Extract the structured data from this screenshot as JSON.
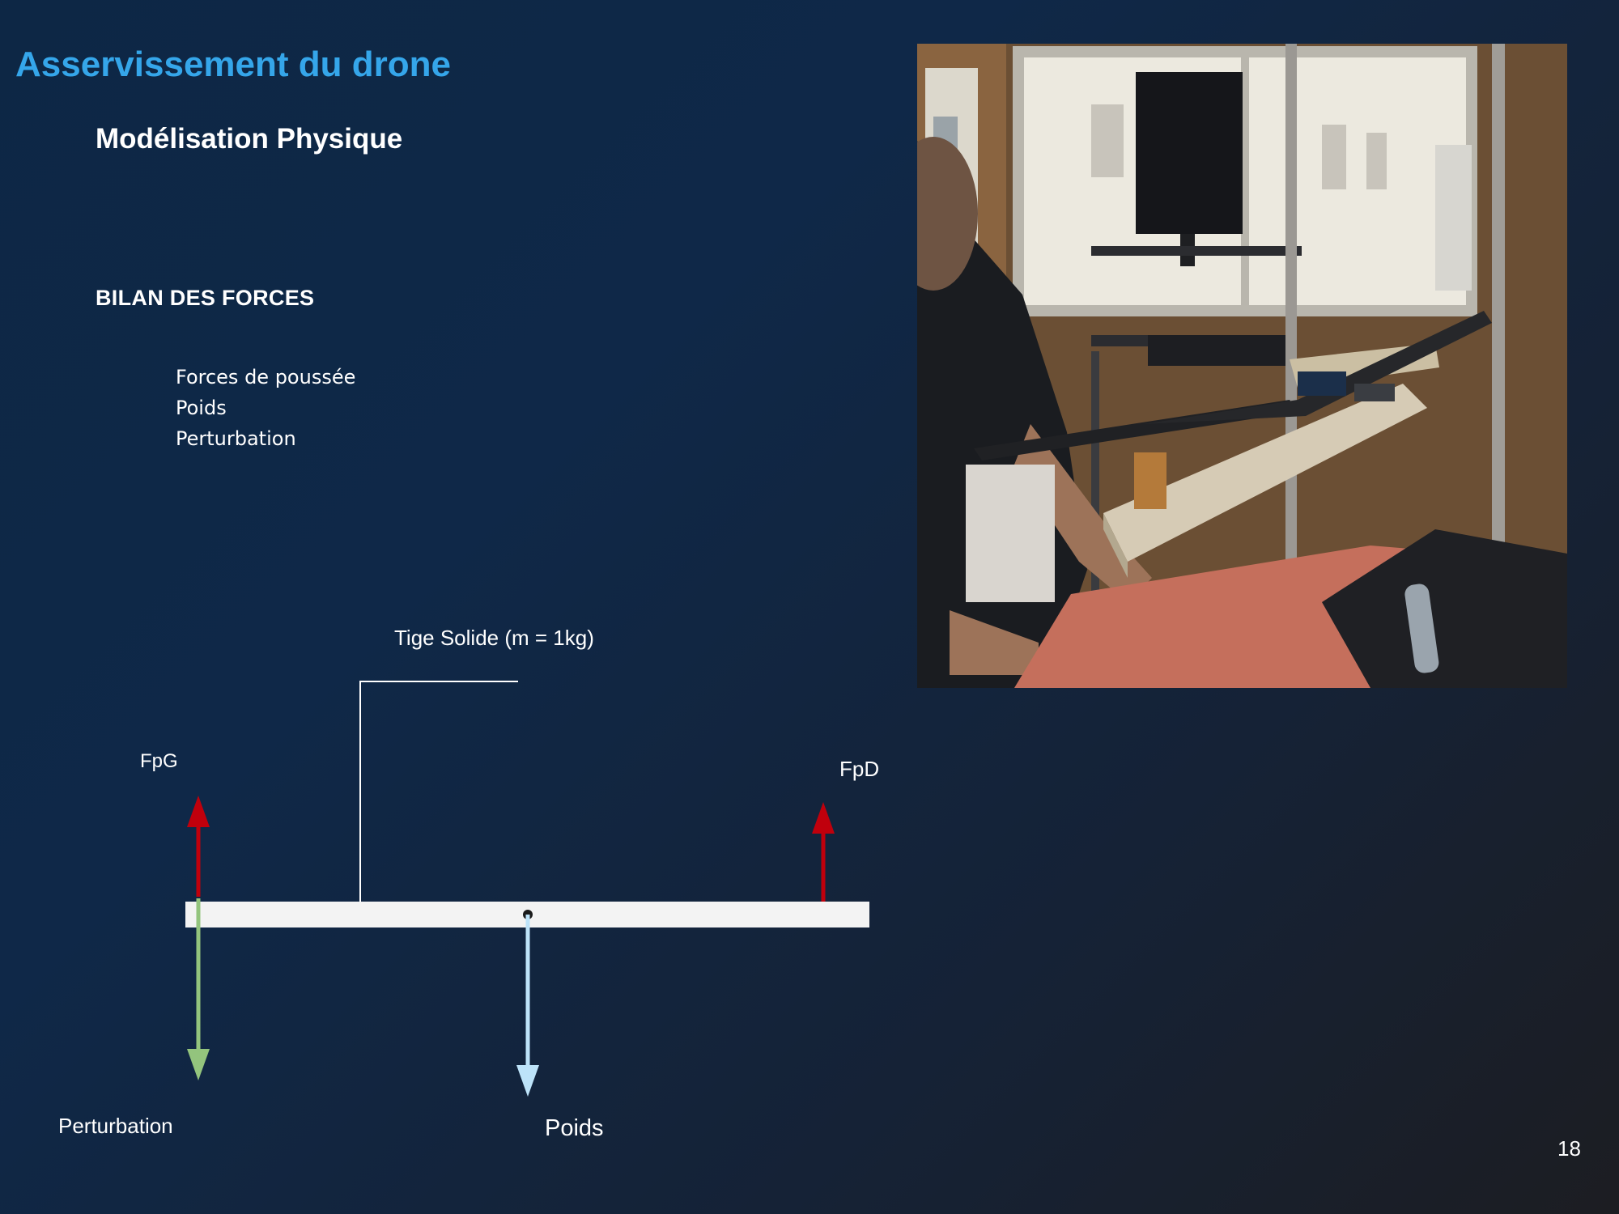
{
  "slide": {
    "title": "Asservissement du drone",
    "subtitle": "Modélisation Physique",
    "section_heading": "BILAN DES FORCES",
    "bullets": [
      "Forces de poussée",
      "Poids",
      "Perturbation"
    ],
    "page_number": "18"
  },
  "diagram": {
    "rod_label": "Tige Solide (m = 1kg)",
    "forces": [
      {
        "label": "FpG",
        "direction": "up",
        "color": "#c0000c"
      },
      {
        "label": "FpD",
        "direction": "up",
        "color": "#c0000c"
      },
      {
        "label": "Perturbation",
        "direction": "down",
        "color": "#93c47d"
      },
      {
        "label": "Poids",
        "direction": "down",
        "color": "#bde3f9"
      }
    ]
  },
  "photo": {
    "subject": "drone test bench photograph",
    "icon": "photo-image"
  },
  "colors": {
    "title": "#35a6ea",
    "background_start": "#0d2745",
    "background_end": "#1c1d22",
    "rod": "#f3f3f3"
  }
}
